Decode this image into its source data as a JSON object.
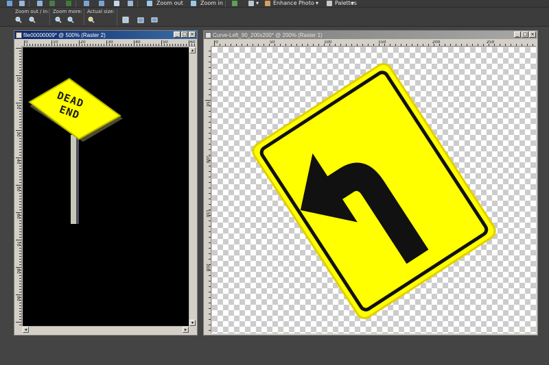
{
  "toolbar": {
    "zoom_out_label": "Zoom out",
    "zoom_in_label": "Zoom in",
    "enhance_label": "Enhance Photo",
    "palettes_label": "Palettes"
  },
  "zoombar": {
    "zoom_out_in_label": "Zoom out / in:",
    "zoom_more_label": "Zoom more:",
    "actual_size_label": "Actual size:"
  },
  "window1": {
    "title": "file00000009* @ 500% (Raster 2)",
    "ruler_h": [
      "0",
      "10",
      "20",
      "30",
      "40",
      "50",
      "60"
    ],
    "ruler_v": [
      "10",
      "20",
      "30",
      "40",
      "50",
      "60",
      "70",
      "80",
      "90",
      "100"
    ]
  },
  "window2": {
    "title": "Curve-Left_90_200x200* @ 200% (Raster 1)",
    "ruler_h": [
      "0",
      "50",
      "100",
      "150",
      "200",
      "250"
    ],
    "ruler_v": [
      "50",
      "100",
      "150",
      "200"
    ]
  },
  "sign1": {
    "line1": "DEAD",
    "line2": "END",
    "color": "#ffff00"
  },
  "sign2": {
    "color": "#ffff00",
    "arrow": "curve-left-arrow"
  }
}
